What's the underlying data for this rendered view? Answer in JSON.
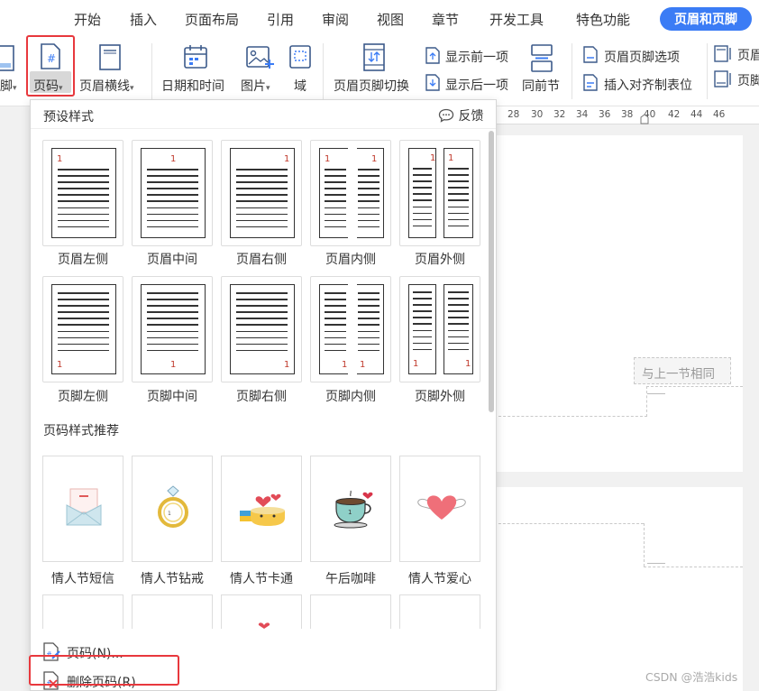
{
  "ribbon": {
    "tabs": [
      {
        "label": "开始"
      },
      {
        "label": "插入"
      },
      {
        "label": "页面布局"
      },
      {
        "label": "引用"
      },
      {
        "label": "审阅"
      },
      {
        "label": "视图"
      },
      {
        "label": "章节"
      },
      {
        "label": "开发工具"
      },
      {
        "label": "特色功能"
      },
      {
        "label": "页眉和页脚",
        "active": true
      }
    ],
    "buttons": {
      "footer": "脚",
      "page_number": "页码",
      "header_line": "页眉横线",
      "date_time": "日期和时间",
      "picture": "图片",
      "field": "域",
      "switch": "页眉页脚切换",
      "show_prev": "显示前一项",
      "show_next": "显示后一项",
      "same_as_prev": "同前节",
      "options": "页眉页脚选项",
      "insert_align_tab": "插入对齐制表位",
      "header_cut": "页眉",
      "footer_cut": "页脚"
    }
  },
  "ruler": {
    "ticks": [
      "28",
      "30",
      "32",
      "34",
      "36",
      "38",
      "40",
      "42",
      "44",
      "46"
    ]
  },
  "document": {
    "same_as_previous_tag": "与上一节相同"
  },
  "dropdown": {
    "preset_title": "预设样式",
    "feedback": "反馈",
    "header_presets": [
      {
        "label": "页眉左侧"
      },
      {
        "label": "页眉中间"
      },
      {
        "label": "页眉右侧"
      },
      {
        "label": "页眉内侧"
      },
      {
        "label": "页眉外侧"
      }
    ],
    "footer_presets": [
      {
        "label": "页脚左侧"
      },
      {
        "label": "页脚中间"
      },
      {
        "label": "页脚右侧"
      },
      {
        "label": "页脚内侧"
      },
      {
        "label": "页脚外侧"
      }
    ],
    "thumb_number": "1",
    "recommend_title": "页码样式推荐",
    "styles": [
      {
        "label": "情人节短信"
      },
      {
        "label": "情人节钻戒"
      },
      {
        "label": "情人节卡通"
      },
      {
        "label": "午后咖啡"
      },
      {
        "label": "情人节爱心"
      }
    ],
    "footer_items": {
      "page_number_dialog": "页码(N)...",
      "delete_page_number": "删除页码(R)"
    }
  },
  "watermark": "CSDN @浩浩kids",
  "colors": {
    "accent": "#3b7cf5",
    "highlight_box": "#e8383d",
    "thumb_number": "#c0392b"
  }
}
